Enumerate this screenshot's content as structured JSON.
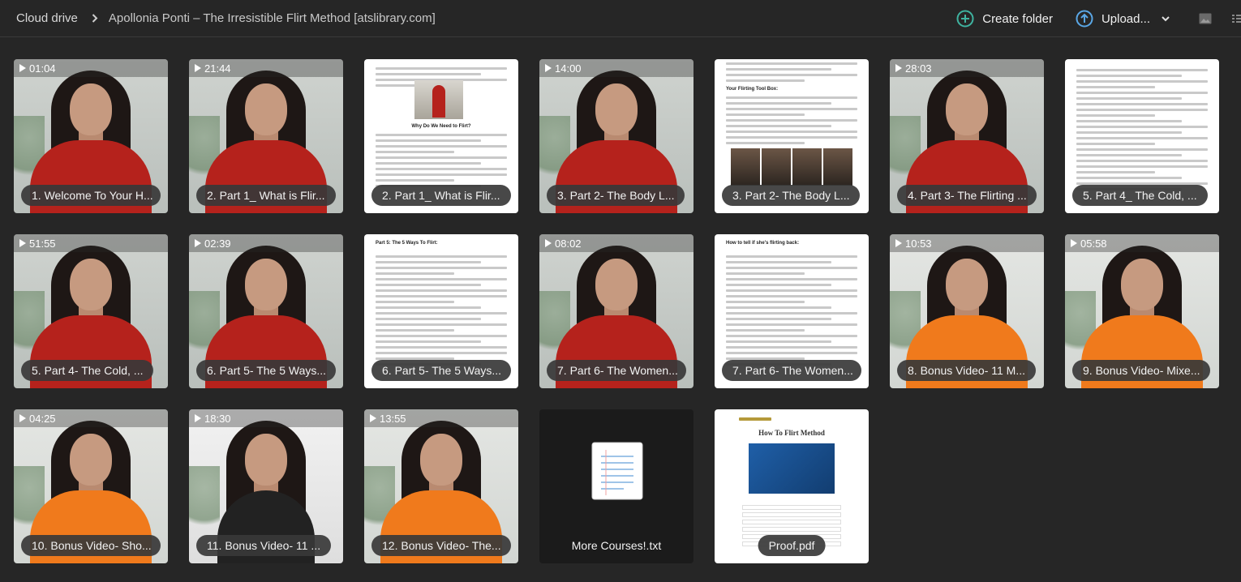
{
  "breadcrumb": {
    "root": "Cloud drive",
    "folder": "Apollonia Ponti – The Irresistible Flirt Method [atslibrary.com]"
  },
  "toolbar": {
    "create_folder": "Create folder",
    "upload": "Upload...",
    "accent": "#3fb3a0",
    "upload_accent": "#5aa7e6"
  },
  "items": [
    {
      "kind": "video",
      "style": "red",
      "duration": "01:04",
      "name": "1. Welcome To Your H..."
    },
    {
      "kind": "video",
      "style": "red",
      "duration": "21:44",
      "name": "2. Part 1_ What is Flir..."
    },
    {
      "kind": "doc",
      "style": "doc-photo",
      "duration": "",
      "name": "2. Part 1_ What is Flir...",
      "doc_title": "Why Do We Need to Flirt?"
    },
    {
      "kind": "video",
      "style": "red",
      "duration": "14:00",
      "name": "3. Part 2- The Body L..."
    },
    {
      "kind": "doc",
      "style": "doc-faces",
      "duration": "",
      "name": "3. Part 2- The Body L...",
      "doc_title": "Your Flirting Tool Box:"
    },
    {
      "kind": "video",
      "style": "red",
      "duration": "28:03",
      "name": "4. Part 3- The Flirting ..."
    },
    {
      "kind": "doc",
      "style": "doc-text",
      "duration": "",
      "name": "5. Part 4_ The Cold, ...",
      "doc_title": ""
    },
    {
      "kind": "video",
      "style": "red",
      "duration": "51:55",
      "name": "5. Part 4- The Cold, ..."
    },
    {
      "kind": "video",
      "style": "red",
      "duration": "02:39",
      "name": "6. Part 5- The 5 Ways..."
    },
    {
      "kind": "doc",
      "style": "doc-text",
      "duration": "",
      "name": "6. Part 5- The 5 Ways...",
      "doc_title": "Part 5: The 5 Ways To Flirt:"
    },
    {
      "kind": "video",
      "style": "red",
      "duration": "08:02",
      "name": "7. Part 6- The Women..."
    },
    {
      "kind": "doc",
      "style": "doc-text",
      "duration": "",
      "name": "7. Part 6- The Women...",
      "doc_title": "How to tell if she's flirting back:"
    },
    {
      "kind": "video",
      "style": "orange",
      "duration": "10:53",
      "name": "8. Bonus Video- 11 M..."
    },
    {
      "kind": "video",
      "style": "orange",
      "duration": "05:58",
      "name": "9. Bonus Video- Mixe..."
    },
    {
      "kind": "video",
      "style": "orange",
      "duration": "04:25",
      "name": "10. Bonus Video- Sho..."
    },
    {
      "kind": "video",
      "style": "studio",
      "duration": "18:30",
      "name": "11. Bonus Video- 11 ..."
    },
    {
      "kind": "video",
      "style": "orange",
      "duration": "13:55",
      "name": "12. Bonus Video- The..."
    },
    {
      "kind": "txt",
      "style": "txt",
      "duration": "",
      "name": "More Courses!.txt"
    },
    {
      "kind": "pdf",
      "style": "pdf",
      "duration": "",
      "name": "Proof.pdf",
      "doc_title": "How To Flirt Method"
    }
  ]
}
